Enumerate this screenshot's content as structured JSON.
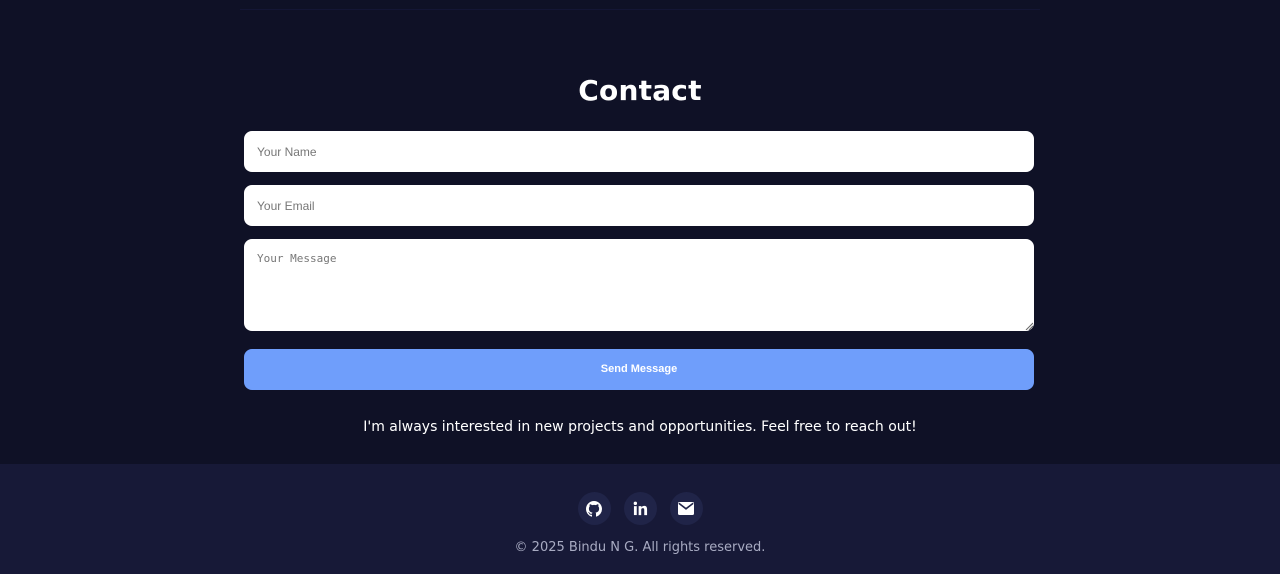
{
  "colors": {
    "page_background": "#0f1126",
    "footer_background": "#171937",
    "accent": "#6f9efb",
    "social_circle": "#202448",
    "copyright_text": "#a8abc2"
  },
  "contact": {
    "title": "Contact",
    "name_placeholder": "Your Name",
    "email_placeholder": "Your Email",
    "message_placeholder": "Your Message",
    "send_label": "Send Message",
    "note": "I'm always interested in new projects and opportunities. Feel free to reach out!"
  },
  "footer": {
    "social": [
      {
        "icon": "github-icon"
      },
      {
        "icon": "linkedin-icon"
      },
      {
        "icon": "envelope-icon"
      }
    ],
    "copyright": "© 2025 Bindu N G. All rights reserved."
  }
}
